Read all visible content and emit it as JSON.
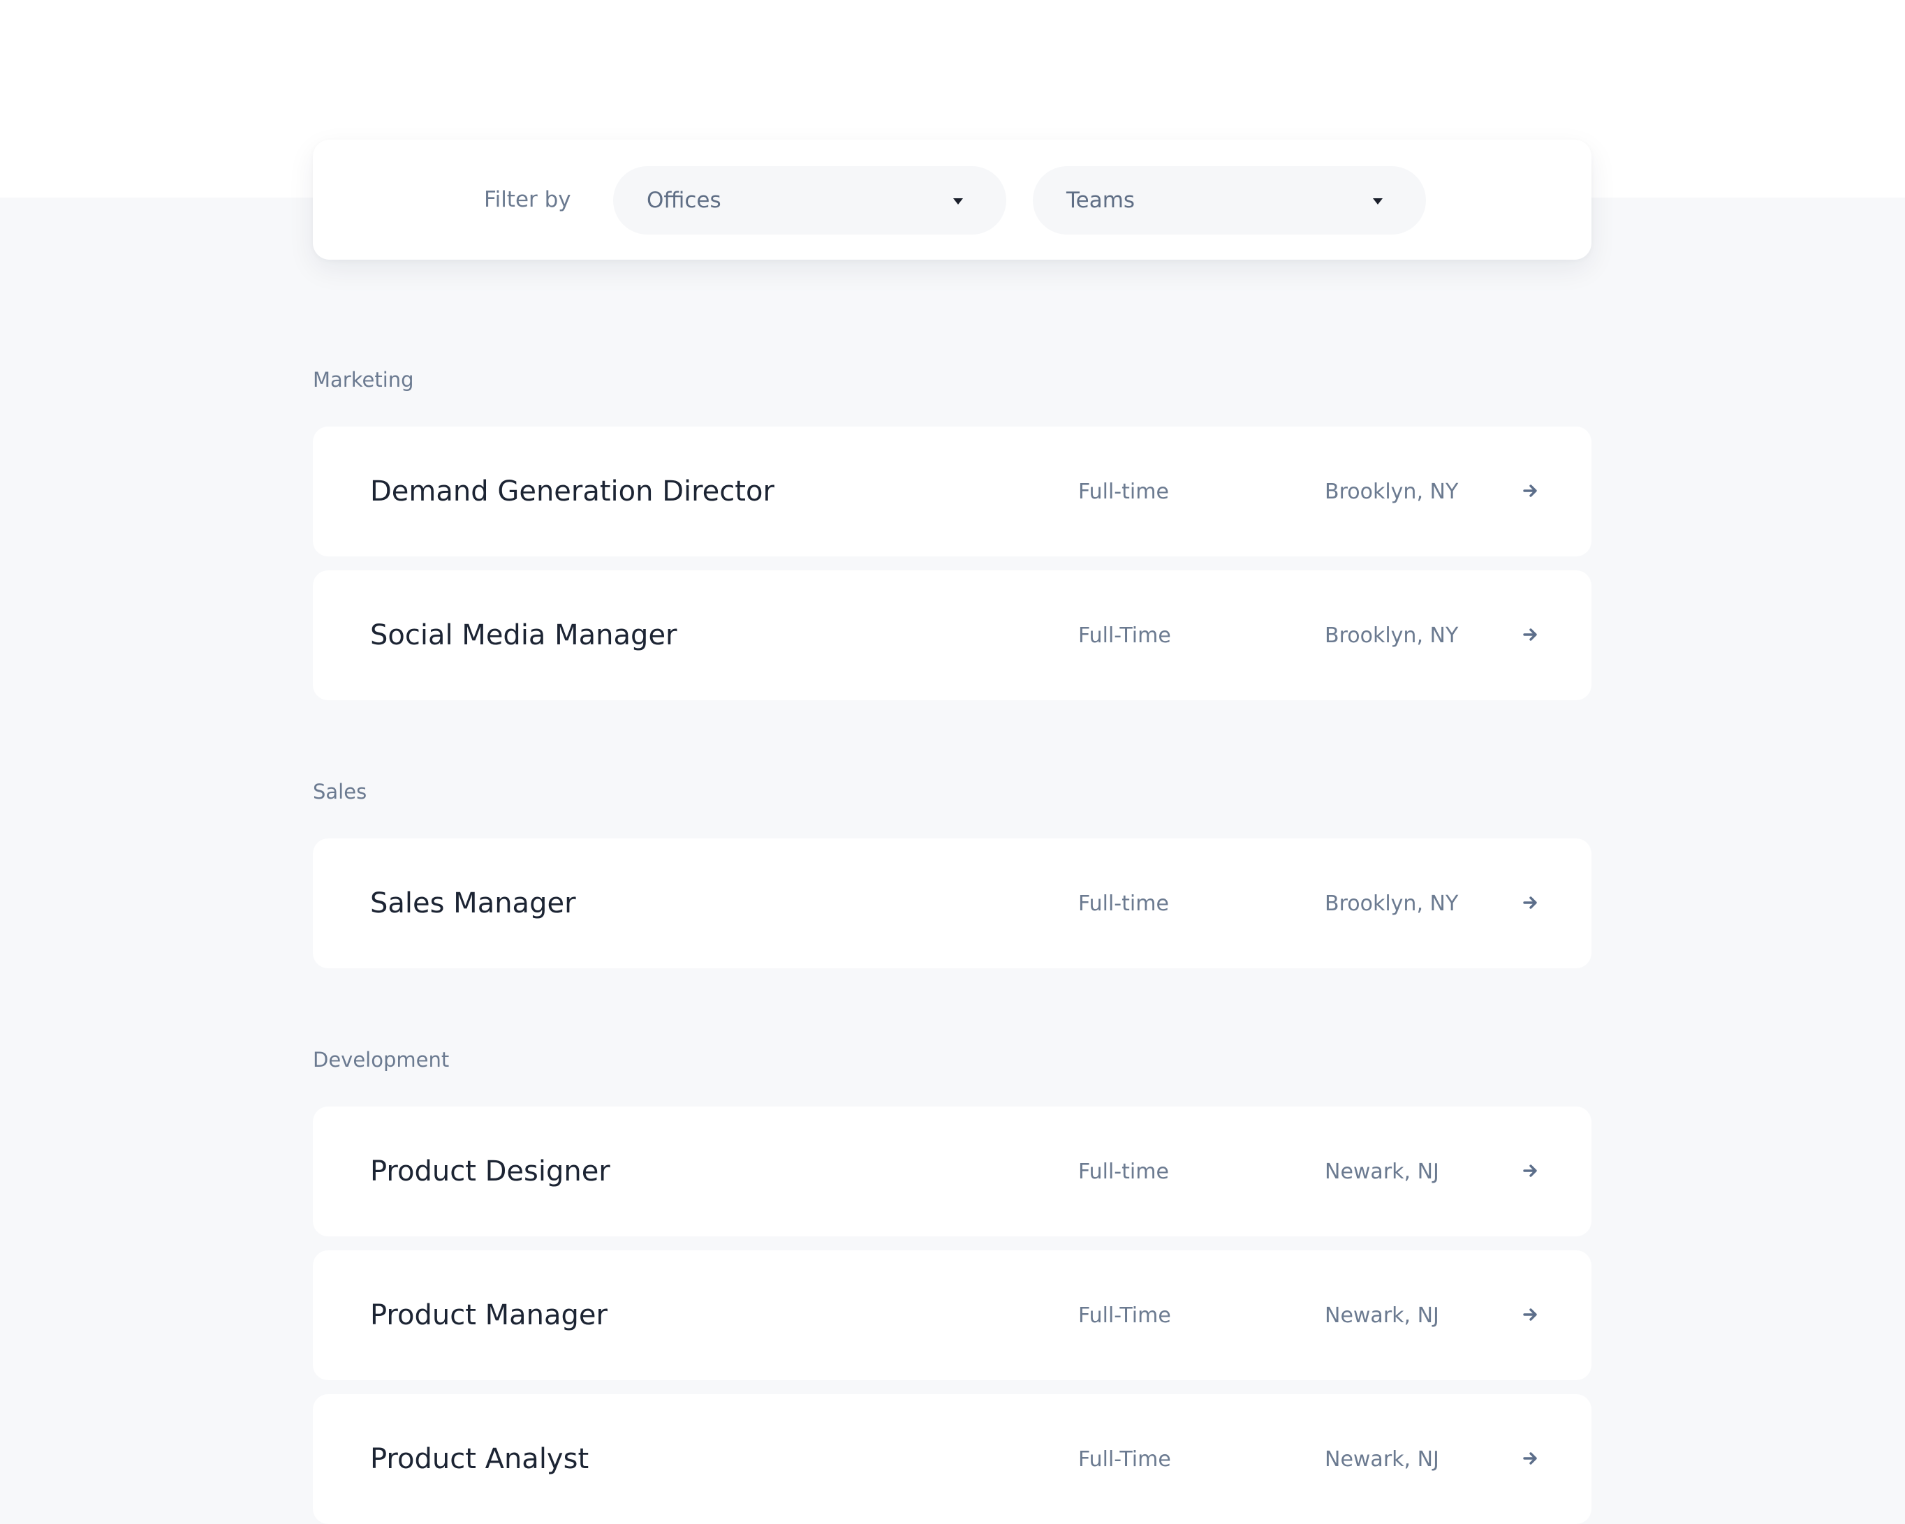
{
  "filter": {
    "label": "Filter by",
    "offices": {
      "value": "Offices"
    },
    "teams": {
      "value": "Teams"
    }
  },
  "sections": [
    {
      "title": "Marketing",
      "jobs": [
        {
          "title": "Demand Generation Director",
          "type": "Full-time",
          "location": "Brooklyn, NY"
        },
        {
          "title": "Social Media Manager",
          "type": "Full-Time",
          "location": "Brooklyn, NY"
        }
      ]
    },
    {
      "title": "Sales",
      "jobs": [
        {
          "title": "Sales Manager",
          "type": "Full-time",
          "location": "Brooklyn, NY"
        }
      ]
    },
    {
      "title": "Development",
      "jobs": [
        {
          "title": "Product Designer",
          "type": "Full-time",
          "location": "Newark, NJ"
        },
        {
          "title": "Product Manager",
          "type": "Full-Time",
          "location": "Newark, NJ"
        },
        {
          "title": "Product Analyst",
          "type": "Full-Time",
          "location": "Newark, NJ"
        }
      ]
    }
  ],
  "icons": {
    "arrow": "arrow-right-icon",
    "caret": "caret-down-icon"
  },
  "colors": {
    "page_background": "#f7f8fa",
    "card_background": "#ffffff",
    "muted_text": "#6b7a90",
    "title_text": "#1c2433",
    "arrow": "#5c6e8a"
  }
}
